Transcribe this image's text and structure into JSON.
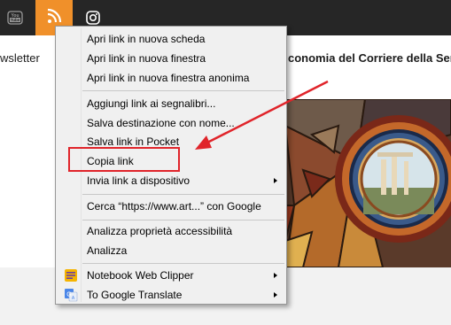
{
  "social": {
    "youtube_label": "You Tube",
    "rss_color": "#f0902a"
  },
  "page": {
    "newsletter_text": "wsletter",
    "headline_text": "conomia del Corriere della Sera"
  },
  "context_menu": {
    "items": [
      {
        "label": "Apri link in nuova scheda",
        "submenu": false
      },
      {
        "label": "Apri link in nuova finestra",
        "submenu": false
      },
      {
        "label": "Apri link in nuova finestra anonima",
        "submenu": false
      },
      {
        "label": "Aggiungi link ai segnalibri...",
        "submenu": false
      },
      {
        "label": "Salva destinazione con nome...",
        "submenu": false
      },
      {
        "label": "Salva link in Pocket",
        "submenu": false
      },
      {
        "label": "Copia link",
        "submenu": false
      },
      {
        "label": "Invia link a dispositivo",
        "submenu": true
      },
      {
        "label": "Cerca “https://www.art...” con Google",
        "submenu": false
      },
      {
        "label": "Analizza proprietà accessibilità",
        "submenu": false
      },
      {
        "label": "Analizza",
        "submenu": false
      },
      {
        "label": "Notebook Web Clipper",
        "submenu": true,
        "icon": "notebook-clipper-icon"
      },
      {
        "label": "To Google Translate",
        "submenu": true,
        "icon": "google-translate-icon"
      }
    ]
  },
  "annotation": {
    "color": "#e0242a",
    "highlighted_item": "Copia link"
  }
}
